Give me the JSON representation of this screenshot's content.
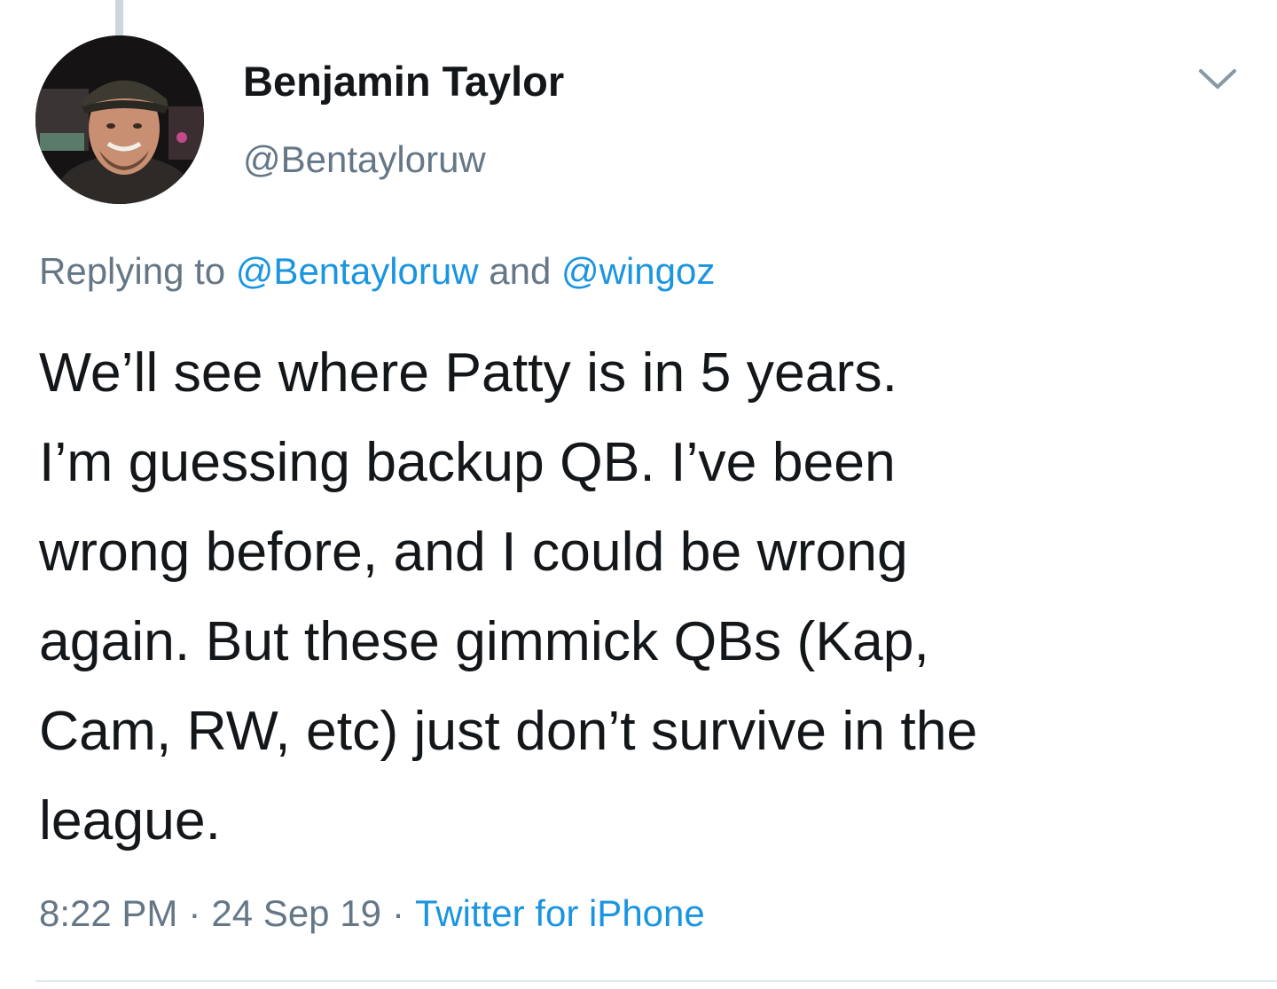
{
  "tweet": {
    "author": {
      "display_name": "Benjamin Taylor",
      "handle": "@Bentayloruw"
    },
    "replying": {
      "prefix": "Replying to",
      "mention_1": "@Bentayloruw",
      "conjunction": "and",
      "mention_2": "@wingoz"
    },
    "text_lines": [
      "We’ll see where Patty is in 5 years.",
      "I’m guessing backup QB. I’ve been",
      "wrong before, and I could be wrong",
      "again. But these gimmick QBs (Kap,",
      "Cam, RW, etc) just don’t survive in the",
      "league."
    ],
    "meta": {
      "time": "8:22 PM",
      "separator": "·",
      "date": "24 Sep 19",
      "source": "Twitter for iPhone"
    },
    "icons": {
      "menu": "chevron-down-icon",
      "avatar": "avatar"
    },
    "colors": {
      "text": "#14171a",
      "secondary": "#657786",
      "link": "#1b95e0"
    }
  }
}
